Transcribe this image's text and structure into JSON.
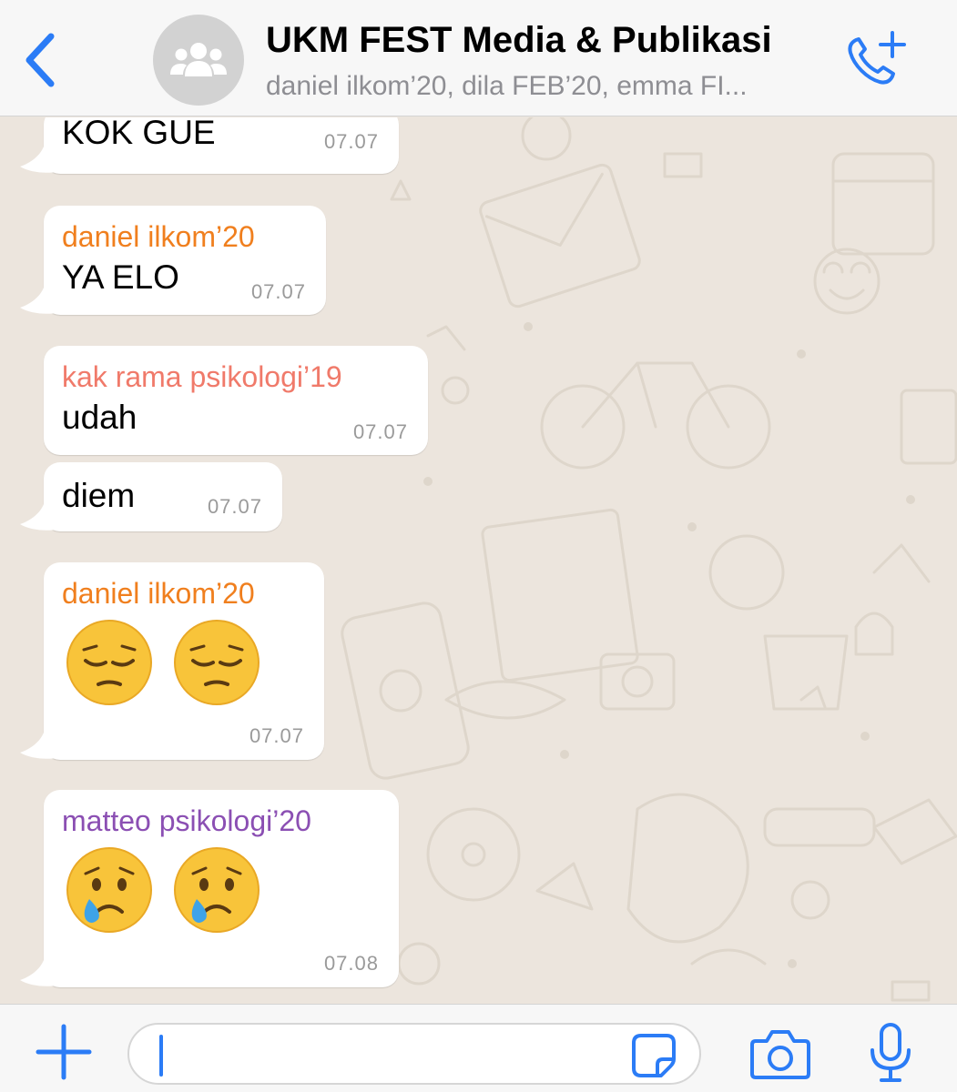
{
  "header": {
    "back_icon": "chevron-left-icon",
    "avatar_icon": "group-icon",
    "title": "UKM FEST Media & Publikasi",
    "subtitle": "daniel ilkom’20, dila FEB’20, emma FI...",
    "call_icon": "add-call-icon"
  },
  "colors": {
    "accent": "#2b7cf6",
    "sender_daniel": "#f07f1e",
    "sender_rama": "#f07a6a",
    "sender_matteo": "#8b4fb3",
    "chat_background": "#ece5dd",
    "bubble": "#ffffff"
  },
  "messages": [
    {
      "text": "KOK GUE",
      "time": "07.07"
    },
    {
      "sender": "daniel ilkom’20",
      "text": "YA ELO",
      "time": "07.07"
    },
    {
      "sender": "kak rama psikologi’19",
      "text": "udah",
      "time": "07.07"
    },
    {
      "text": "diem",
      "time": "07.07"
    },
    {
      "sender": "daniel ilkom’20",
      "emoji": [
        "pensive-face-emoji",
        "pensive-face-emoji"
      ],
      "time": "07.07"
    },
    {
      "sender": "matteo psikologi’20",
      "emoji": [
        "crying-face-emoji",
        "crying-face-emoji"
      ],
      "time": "07.08"
    }
  ],
  "inputbar": {
    "plus_icon": "plus-icon",
    "message_value": "",
    "sticker_icon": "sticker-icon",
    "camera_icon": "camera-icon",
    "mic_icon": "microphone-icon"
  }
}
